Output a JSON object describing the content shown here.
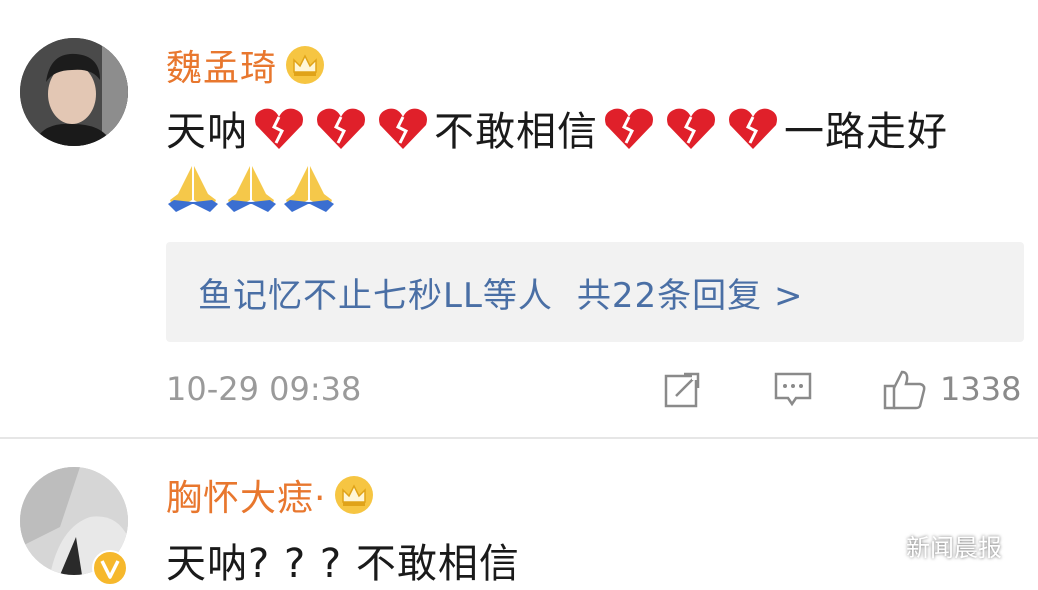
{
  "comments": [
    {
      "username": "魏孟琦",
      "text_part1": "天呐",
      "text_part2": "不敢相信",
      "text_part3": "一路走好",
      "replies": {
        "names": "鱼记忆不止七秒LL等人",
        "count": "共22条回复 >"
      },
      "timestamp": "10-29 09:38",
      "likes": "1338"
    },
    {
      "username": "胸怀大痣·",
      "text": "天呐? ? ? 不敢相信"
    }
  ],
  "icons": {
    "crown": "crown-vip-icon",
    "broken_heart": "broken-heart-emoji",
    "pray": "praying-hands-emoji",
    "repost": "repost-icon",
    "comment": "comment-icon",
    "like": "thumbs-up-icon",
    "verified": "verified-v-badge-icon"
  },
  "colors": {
    "username": "#e8772e",
    "reply_link": "#4a6fa5",
    "meta": "#9a9a9a",
    "reply_bg": "#f2f2f2"
  },
  "watermark": "新闻晨报"
}
